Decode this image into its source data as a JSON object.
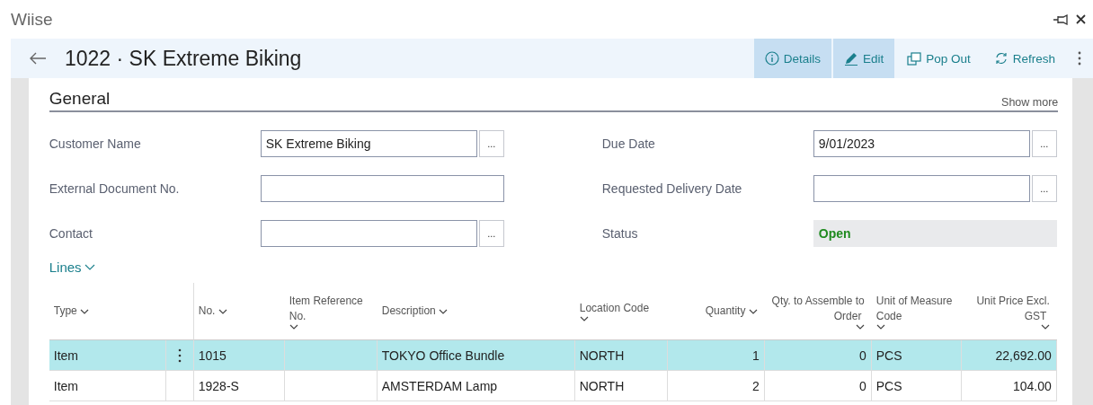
{
  "app": {
    "title": "Wiise"
  },
  "header": {
    "title": "1022 · SK Extreme Biking",
    "actions": [
      {
        "kind": "info",
        "label": "Details",
        "active": true
      },
      {
        "kind": "edit",
        "label": "Edit",
        "active": true
      },
      {
        "kind": "popout",
        "label": "Pop Out",
        "active": false
      },
      {
        "kind": "refresh",
        "label": "Refresh",
        "active": false
      }
    ]
  },
  "general": {
    "title": "General",
    "show_more": "Show more",
    "fields": [
      {
        "label": "Customer Name",
        "kind": "lookup",
        "value": "SK Extreme Biking",
        "button": "..."
      },
      {
        "label": "Due Date",
        "kind": "lookup",
        "value": "9/01/2023",
        "button": "..."
      },
      {
        "label": "External Document No.",
        "kind": "text"
      },
      {
        "label": "Requested Delivery Date",
        "kind": "lookup",
        "button": "..."
      },
      {
        "label": "Contact",
        "kind": "lookup",
        "button": "..."
      },
      {
        "label": "Status",
        "kind": "status",
        "value": "Open"
      }
    ]
  },
  "lines": {
    "title": "Lines",
    "columns": [
      {
        "label": "Type",
        "kind": "text"
      },
      {
        "label": "No.",
        "kind": "text"
      },
      {
        "label": "Item Reference No.",
        "kind": "text"
      },
      {
        "label": "Description",
        "kind": "text"
      },
      {
        "label": "Location Code",
        "kind": "text"
      },
      {
        "label": "Quantity",
        "kind": "number"
      },
      {
        "label": "Qty. to Assemble to Order",
        "kind": "number"
      },
      {
        "label": "Unit of Measure Code",
        "kind": "text"
      },
      {
        "label": "Unit Price Excl. GST",
        "kind": "number"
      }
    ],
    "rows": [
      {
        "selected": true,
        "cells": [
          "Item",
          "1015",
          "",
          "TOKYO Office Bundle",
          "NORTH",
          "1",
          "0",
          "PCS",
          "22,692.00"
        ]
      },
      {
        "selected": false,
        "cells": [
          "Item",
          "1928-S",
          "",
          "AMSTERDAM Lamp",
          "NORTH",
          "2",
          "0",
          "PCS",
          "104.00"
        ]
      }
    ]
  }
}
